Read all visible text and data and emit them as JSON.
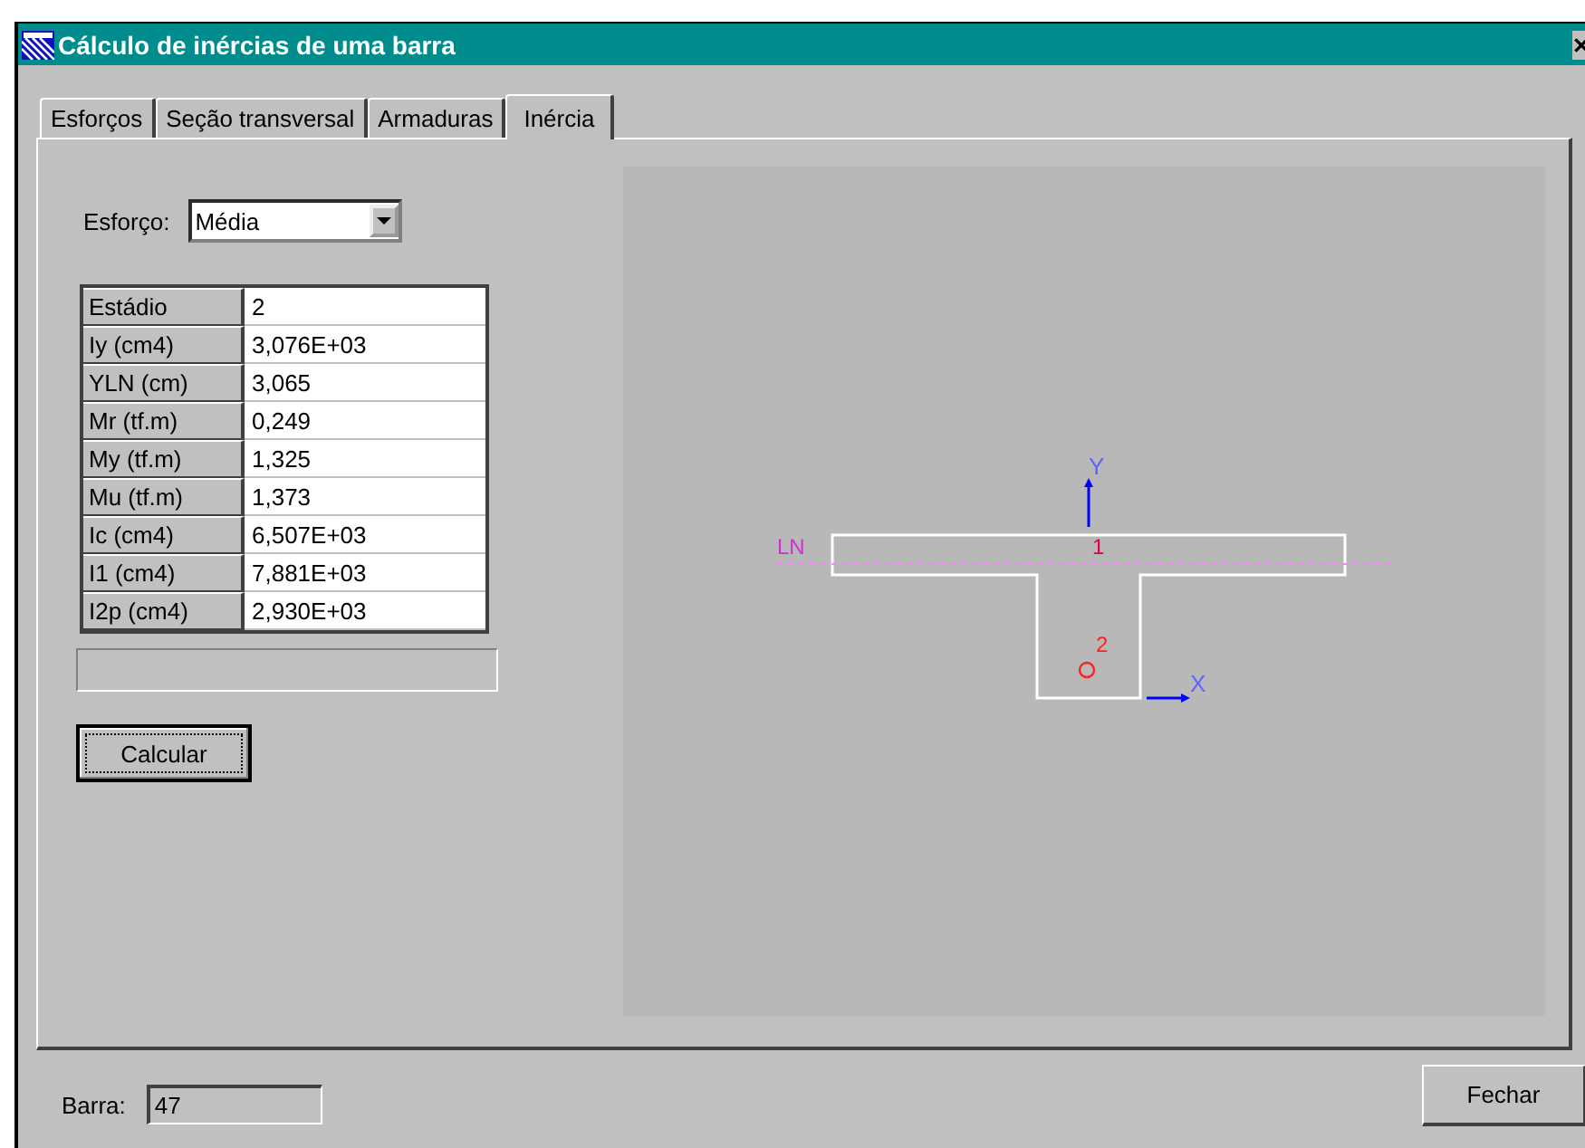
{
  "window": {
    "title": "Cálculo de inércias de uma barra"
  },
  "tabs": [
    {
      "label": "Esforços",
      "selected": false
    },
    {
      "label": "Seção transversal",
      "selected": false
    },
    {
      "label": "Armaduras",
      "selected": false
    },
    {
      "label": "Inércia",
      "selected": true
    }
  ],
  "esforco": {
    "label": "Esforço:",
    "value": "Média"
  },
  "results": [
    {
      "name": "Estádio",
      "value": "2"
    },
    {
      "name": "Iy (cm4)",
      "value": "3,076E+03"
    },
    {
      "name": "YLN (cm)",
      "value": "3,065"
    },
    {
      "name": "Mr (tf.m)",
      "value": "0,249"
    },
    {
      "name": "My (tf.m)",
      "value": "1,325"
    },
    {
      "name": "Mu (tf.m)",
      "value": "1,373"
    },
    {
      "name": "Ic (cm4)",
      "value": "6,507E+03"
    },
    {
      "name": "I1 (cm4)",
      "value": "7,881E+03"
    },
    {
      "name": "I2p (cm4)",
      "value": "2,930E+03"
    }
  ],
  "calculate_button": "Calcular",
  "section_drawing": {
    "y_axis": "Y",
    "x_axis": "X",
    "neutral_line": "LN",
    "point_1": "1",
    "point_2": "2"
  },
  "barra": {
    "label": "Barra:",
    "value": "47"
  },
  "close_button": "Fechar"
}
